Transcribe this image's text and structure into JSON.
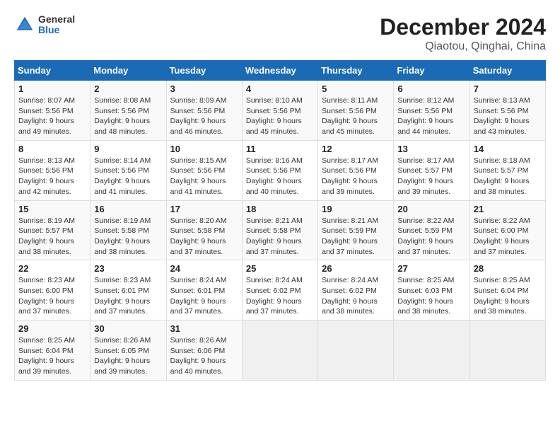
{
  "header": {
    "logo_general": "General",
    "logo_blue": "Blue",
    "title": "December 2024",
    "subtitle": "Qiaotou, Qinghai, China"
  },
  "calendar": {
    "days_of_week": [
      "Sunday",
      "Monday",
      "Tuesday",
      "Wednesday",
      "Thursday",
      "Friday",
      "Saturday"
    ],
    "weeks": [
      [
        {
          "day": "1",
          "sunrise": "8:07 AM",
          "sunset": "5:56 PM",
          "daylight": "9 hours and 49 minutes."
        },
        {
          "day": "2",
          "sunrise": "8:08 AM",
          "sunset": "5:56 PM",
          "daylight": "9 hours and 48 minutes."
        },
        {
          "day": "3",
          "sunrise": "8:09 AM",
          "sunset": "5:56 PM",
          "daylight": "9 hours and 46 minutes."
        },
        {
          "day": "4",
          "sunrise": "8:10 AM",
          "sunset": "5:56 PM",
          "daylight": "9 hours and 45 minutes."
        },
        {
          "day": "5",
          "sunrise": "8:11 AM",
          "sunset": "5:56 PM",
          "daylight": "9 hours and 45 minutes."
        },
        {
          "day": "6",
          "sunrise": "8:12 AM",
          "sunset": "5:56 PM",
          "daylight": "9 hours and 44 minutes."
        },
        {
          "day": "7",
          "sunrise": "8:13 AM",
          "sunset": "5:56 PM",
          "daylight": "9 hours and 43 minutes."
        }
      ],
      [
        {
          "day": "8",
          "sunrise": "8:13 AM",
          "sunset": "5:56 PM",
          "daylight": "9 hours and 42 minutes."
        },
        {
          "day": "9",
          "sunrise": "8:14 AM",
          "sunset": "5:56 PM",
          "daylight": "9 hours and 41 minutes."
        },
        {
          "day": "10",
          "sunrise": "8:15 AM",
          "sunset": "5:56 PM",
          "daylight": "9 hours and 41 minutes."
        },
        {
          "day": "11",
          "sunrise": "8:16 AM",
          "sunset": "5:56 PM",
          "daylight": "9 hours and 40 minutes."
        },
        {
          "day": "12",
          "sunrise": "8:17 AM",
          "sunset": "5:56 PM",
          "daylight": "9 hours and 39 minutes."
        },
        {
          "day": "13",
          "sunrise": "8:17 AM",
          "sunset": "5:57 PM",
          "daylight": "9 hours and 39 minutes."
        },
        {
          "day": "14",
          "sunrise": "8:18 AM",
          "sunset": "5:57 PM",
          "daylight": "9 hours and 38 minutes."
        }
      ],
      [
        {
          "day": "15",
          "sunrise": "8:19 AM",
          "sunset": "5:57 PM",
          "daylight": "9 hours and 38 minutes."
        },
        {
          "day": "16",
          "sunrise": "8:19 AM",
          "sunset": "5:58 PM",
          "daylight": "9 hours and 38 minutes."
        },
        {
          "day": "17",
          "sunrise": "8:20 AM",
          "sunset": "5:58 PM",
          "daylight": "9 hours and 37 minutes."
        },
        {
          "day": "18",
          "sunrise": "8:21 AM",
          "sunset": "5:58 PM",
          "daylight": "9 hours and 37 minutes."
        },
        {
          "day": "19",
          "sunrise": "8:21 AM",
          "sunset": "5:59 PM",
          "daylight": "9 hours and 37 minutes."
        },
        {
          "day": "20",
          "sunrise": "8:22 AM",
          "sunset": "5:59 PM",
          "daylight": "9 hours and 37 minutes."
        },
        {
          "day": "21",
          "sunrise": "8:22 AM",
          "sunset": "6:00 PM",
          "daylight": "9 hours and 37 minutes."
        }
      ],
      [
        {
          "day": "22",
          "sunrise": "8:23 AM",
          "sunset": "6:00 PM",
          "daylight": "9 hours and 37 minutes."
        },
        {
          "day": "23",
          "sunrise": "8:23 AM",
          "sunset": "6:01 PM",
          "daylight": "9 hours and 37 minutes."
        },
        {
          "day": "24",
          "sunrise": "8:24 AM",
          "sunset": "6:01 PM",
          "daylight": "9 hours and 37 minutes."
        },
        {
          "day": "25",
          "sunrise": "8:24 AM",
          "sunset": "6:02 PM",
          "daylight": "9 hours and 37 minutes."
        },
        {
          "day": "26",
          "sunrise": "8:24 AM",
          "sunset": "6:02 PM",
          "daylight": "9 hours and 38 minutes."
        },
        {
          "day": "27",
          "sunrise": "8:25 AM",
          "sunset": "6:03 PM",
          "daylight": "9 hours and 38 minutes."
        },
        {
          "day": "28",
          "sunrise": "8:25 AM",
          "sunset": "6:04 PM",
          "daylight": "9 hours and 38 minutes."
        }
      ],
      [
        {
          "day": "29",
          "sunrise": "8:25 AM",
          "sunset": "6:04 PM",
          "daylight": "9 hours and 39 minutes."
        },
        {
          "day": "30",
          "sunrise": "8:26 AM",
          "sunset": "6:05 PM",
          "daylight": "9 hours and 39 minutes."
        },
        {
          "day": "31",
          "sunrise": "8:26 AM",
          "sunset": "6:06 PM",
          "daylight": "9 hours and 40 minutes."
        },
        null,
        null,
        null,
        null
      ]
    ]
  }
}
